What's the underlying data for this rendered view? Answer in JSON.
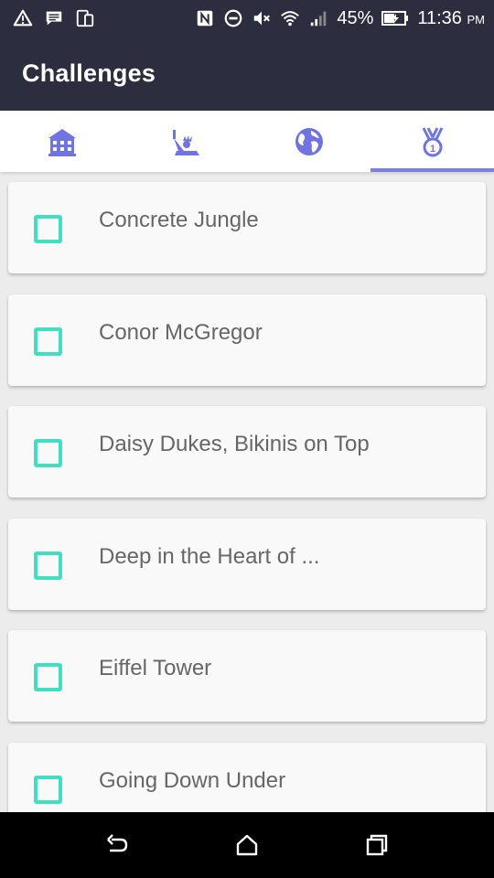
{
  "status_bar": {
    "battery": "45%",
    "time": "11:36",
    "ampm": "PM",
    "icons": [
      "alert-icon",
      "message-icon",
      "device-icon",
      "nfc-icon",
      "dnd-icon",
      "mute-icon",
      "wifi-icon",
      "signal-icon",
      "battery-icon"
    ]
  },
  "app": {
    "title": "Challenges"
  },
  "tabs": [
    {
      "icon": "building-icon"
    },
    {
      "icon": "statue-of-liberty-icon"
    },
    {
      "icon": "globe-icon"
    },
    {
      "icon": "medal-icon",
      "active": true
    }
  ],
  "challenges": [
    {
      "label": "Concrete Jungle",
      "checked": false
    },
    {
      "label": "Conor McGregor",
      "checked": false
    },
    {
      "label": "Daisy Dukes, Bikinis on Top",
      "checked": false
    },
    {
      "label": "Deep in the Heart of ...",
      "checked": false
    },
    {
      "label": "Eiffel Tower",
      "checked": false
    },
    {
      "label": "Going Down Under",
      "checked": false
    }
  ],
  "colors": {
    "header_bg": "#2c2d3f",
    "tab_accent": "#7b7fdf",
    "checkbox": "#40dfc4",
    "card_bg": "#f9f9f9",
    "label_text": "#666666"
  },
  "navbar": [
    "back-icon",
    "home-icon",
    "recents-icon"
  ]
}
